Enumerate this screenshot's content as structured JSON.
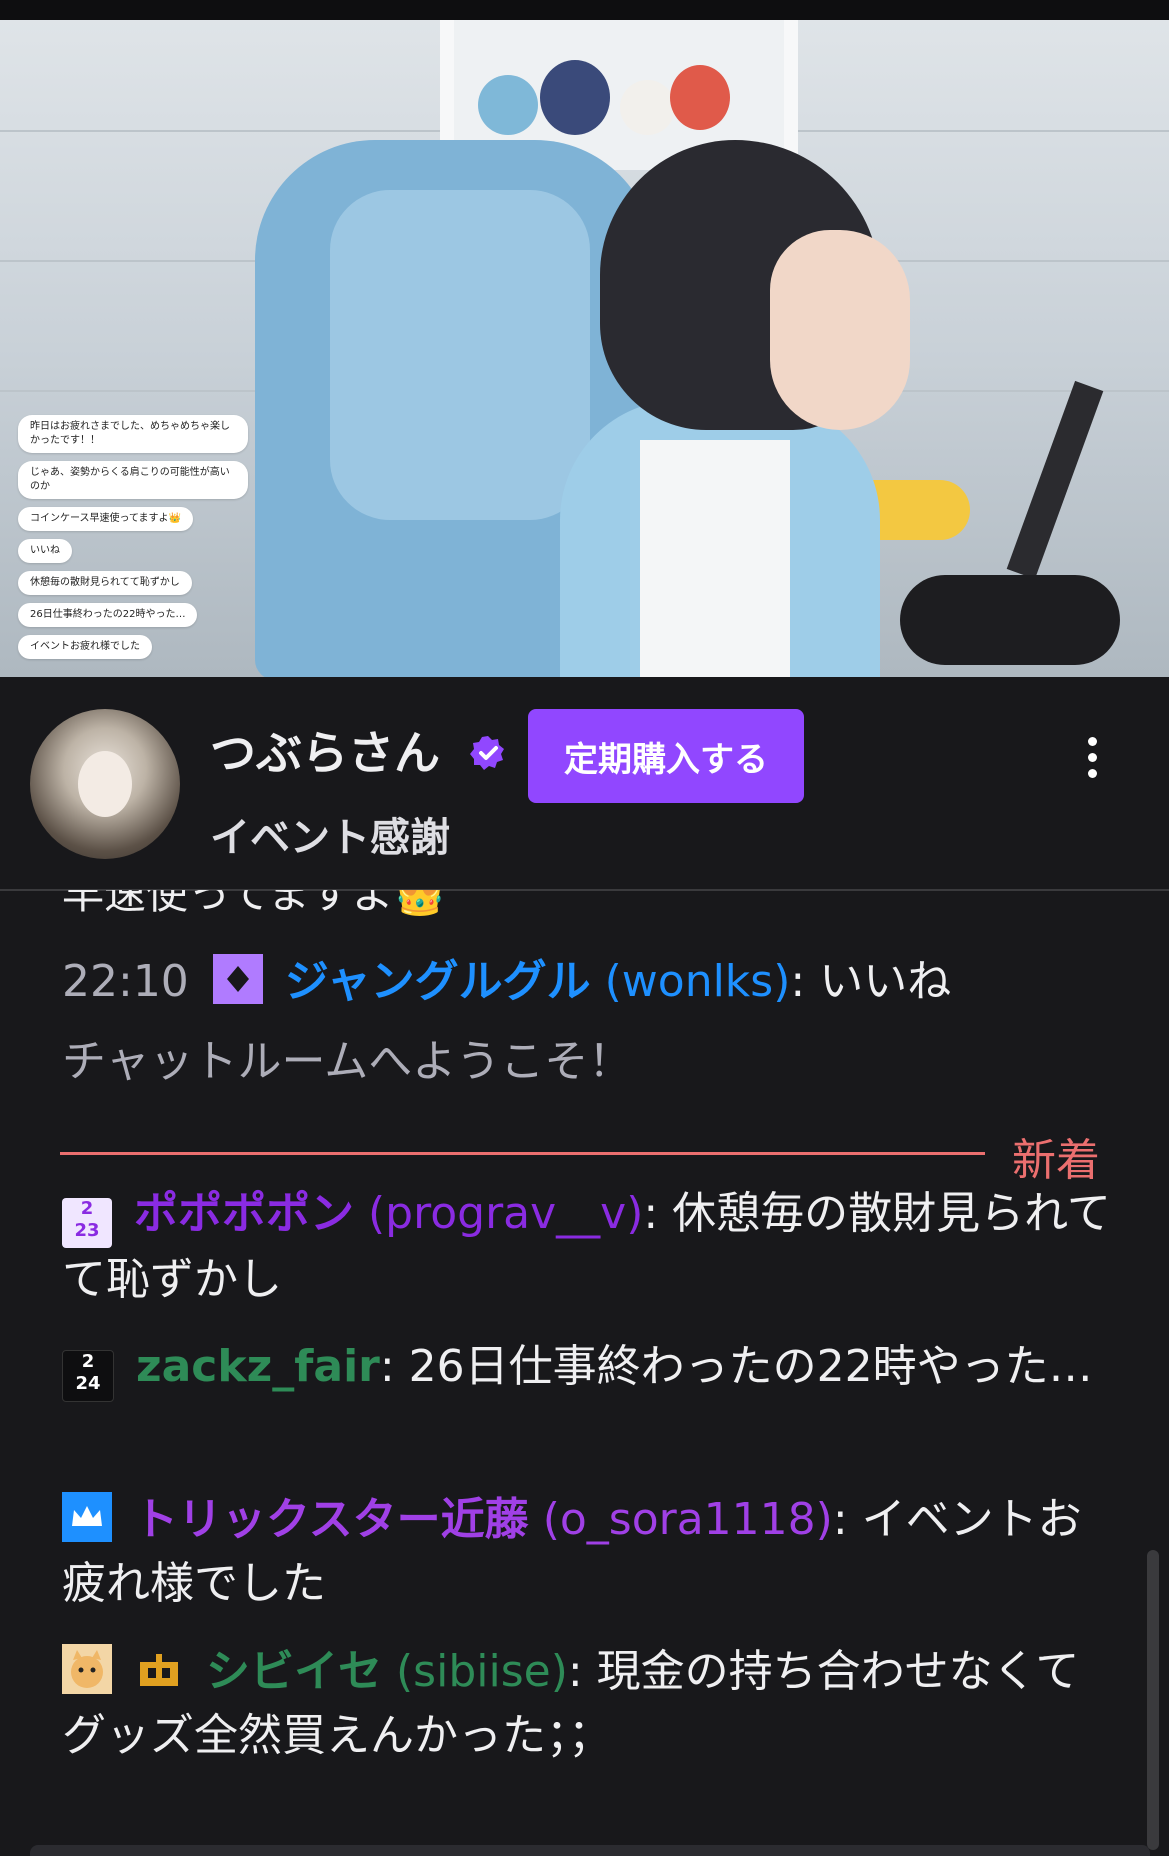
{
  "video": {
    "overlay_chat": [
      "昨日はお疲れさまでした、めちゃめちゃ楽しかったです！！",
      "じゃあ、姿勢からくる肩こりの可能性が高いのか",
      "コインケース早速使ってますよ👑",
      "いいね",
      "休憩毎の散財見られてて恥ずかし",
      "26日仕事終わったの22時やった…",
      "イベントお疲れ様でした"
    ]
  },
  "channel": {
    "name": "つぶらさん",
    "subscribe_label": "定期購入する",
    "stream_title": "イベント感謝",
    "accent": "#9147ff"
  },
  "chat": {
    "cut_text": "早速使ってますよ👑",
    "messages": [
      {
        "time": "22:10",
        "badge": "prime",
        "display": "ジャングルグル",
        "login": "(wonlks)",
        "text": ": いいね",
        "color": "#1e90ff"
      },
      {
        "system": "チャットルームへようこそ！"
      },
      {
        "badge": "2023",
        "display": "ポポポポン",
        "login": "(prograv__v)",
        "text": ": 休憩毎の散財見られてて恥ずかし",
        "color": "#8a2be2"
      },
      {
        "badge": "2024",
        "display": "zackz_fair",
        "text": ": 26日仕事終わったの22時やった…",
        "color": "#2e8b57"
      },
      {
        "badge": "crown",
        "display": "トリックスター近藤",
        "login": "(o_sora1118)",
        "text": ": イベントお疲れ様でした",
        "color": "#a040e6"
      },
      {
        "badge": "cat",
        "display": "シビイセ",
        "login": "(sibiise)",
        "text": ": 現金の持ち合わせなくてグッズ全然買えんかった；；",
        "color": "#2e8b57"
      }
    ],
    "new_label": "新着",
    "badge_text": {
      "b2023_top": "2",
      "b2023_bottom": "23",
      "b2024_top": "2",
      "b2024_bottom": "24"
    }
  }
}
